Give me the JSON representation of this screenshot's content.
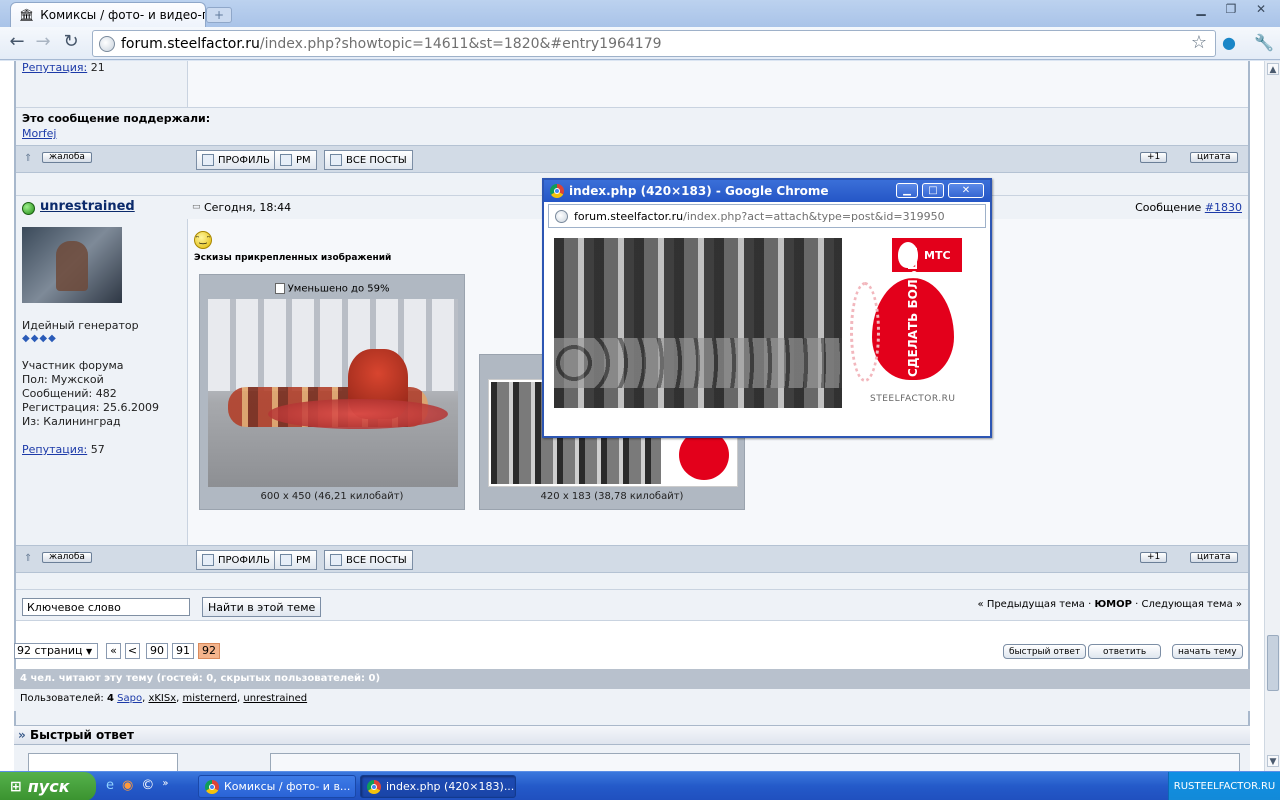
{
  "browser": {
    "tab_title": "Комиксы / фото- и видео-пр",
    "url_host": "forum.steelfactor.ru",
    "url_path": "/index.php?showtopic=14611&st=1820&#entry1964179"
  },
  "post_prev": {
    "reputation_label": "Репутация:",
    "reputation_value": "21",
    "supported_title": "Это сообщение поддержали:",
    "supported_user": "Morfej"
  },
  "actions": {
    "complain": "жалоба",
    "profile": "ПРОФИЛЬ",
    "pm": "PM",
    "all_posts": "ВСЕ ПОСТЫ",
    "plus_one": "+1",
    "quote": "цитата"
  },
  "post": {
    "username": "unrestrained",
    "date": "Сегодня, 18:44",
    "message_label": "Сообщение",
    "message_number": "#1830",
    "rank": "Идейный генератор",
    "group": "Участник форума",
    "gender": "Пол: Мужской",
    "messages": "Сообщений: 482",
    "registered": "Регистрация: 25.6.2009",
    "from": "Из: Калининград",
    "reputation_label": "Репутация:",
    "reputation_value": "57",
    "attachments_title": "Эскизы прикрепленных изображений",
    "reduced_label": "Уменьшено до 59%",
    "thumb1_caption": "600 x 450 (46,21 килобайт)",
    "thumb2_caption": "420 x 183 (38,78 килобайт)"
  },
  "search": {
    "value": "Ключевое слово",
    "button": "Найти в этой теме"
  },
  "topic_nav": {
    "prev": "« Предыдущая тема",
    "sep1": "·",
    "forum": "ЮМОР",
    "sep2": "·",
    "next": "Следующая тема »"
  },
  "pagination": {
    "pages": "92 страниц",
    "first": "«",
    "prev": "<",
    "p1": "90",
    "p2": "91",
    "current": "92"
  },
  "reply_buttons": {
    "quick": "быстрый ответ",
    "reply": "ответить",
    "new_topic": "начать тему"
  },
  "readers": {
    "summary": "4 чел. читают эту тему (гостей: 0, скрытых пользователей: 0)",
    "label": "Пользователей:",
    "count": "4",
    "u1": "Sapo",
    "u2": "xKISx",
    "u3": "misternerd",
    "u4": "unrestrained"
  },
  "quick_reply": {
    "title": "Быстрый ответ"
  },
  "popup": {
    "title": "index.php (420×183) - Google Chrome",
    "url_host": "forum.steelfactor.ru",
    "url_path": "/index.php?act=attach&type=post&id=319950",
    "mts_label": "МТС",
    "slogan": "СДЕЛАТЬ БОЛЬШЕ",
    "site": "STEELFACTOR.RU"
  },
  "taskbar": {
    "start": "пуск",
    "task1": "Комиксы / фото- и в...",
    "task2": "index.php (420×183)...",
    "tray_lang": "RU",
    "tray_site": "STEELFACTOR.RU"
  },
  "colors": {
    "accent": "#2556c6",
    "mts_red": "#e3001b",
    "current_page": "#f4b48c"
  }
}
